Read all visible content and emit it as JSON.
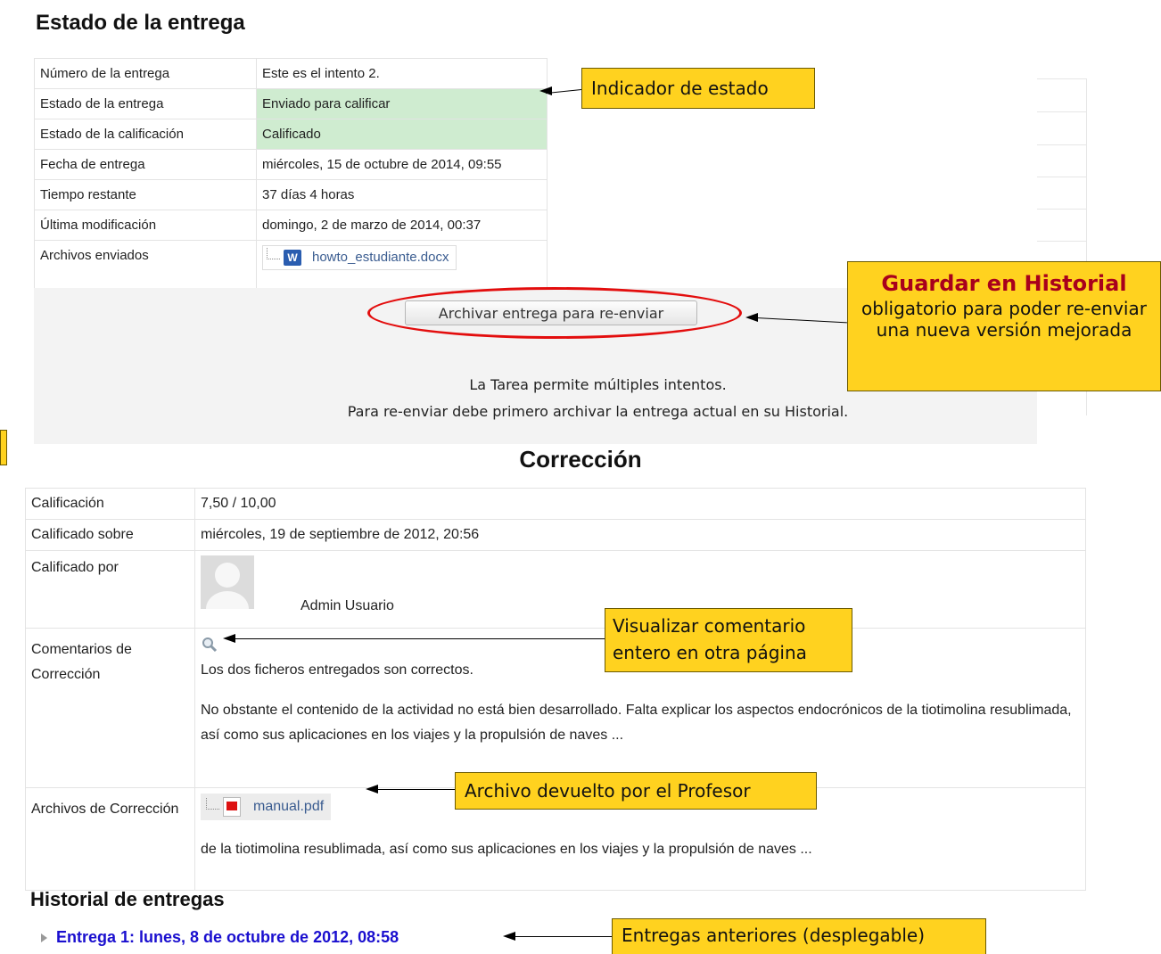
{
  "status": {
    "title": "Estado de la entrega",
    "rows": [
      {
        "label": "Número de la entrega",
        "value": "Este es el intento 2."
      },
      {
        "label": "Estado de la entrega",
        "value": "Enviado para calificar"
      },
      {
        "label": "Estado de la calificación",
        "value": "Calificado"
      },
      {
        "label": "Fecha de entrega",
        "value": "miércoles, 15 de octubre de 2014, 09:55"
      },
      {
        "label": "Tiempo restante",
        "value": "37 días 4 horas"
      },
      {
        "label": "Última modificación",
        "value": "domingo, 2 de marzo de 2014, 00:37"
      },
      {
        "label": "Archivos enviados",
        "value": "howto_estudiante.docx"
      }
    ],
    "highlight_color": "#cfecd0"
  },
  "archive": {
    "button_label": "Archivar entrega para re-enviar",
    "line1": "La Tarea permite múltiples intentos.",
    "line2": "Para re-enviar debe primero archivar la entrega actual en su Historial."
  },
  "correction": {
    "title": "Corrección",
    "grade_label": "Calificación",
    "grade_value": "7,50 / 10,00",
    "graded_on_label": "Calificado sobre",
    "graded_on_value": "miércoles, 19 de septiembre de 2012, 20:56",
    "graded_by_label": "Calificado por",
    "graded_by_value": "Admin Usuario",
    "comments_label": "Comentarios de Corrección",
    "comment_p1": "Los dos ficheros entregados son correctos.",
    "comment_p2": "No obstante el contenido de la actividad no está bien desarrollado.  Falta explicar los aspectos endocrónicos de la tiotimolina resublimada, así como sus aplicaciones en los viajes y la propulsión de naves ...",
    "files_label": "Archivos de Corrección",
    "file_name": "manual.pdf",
    "files_extra": "de la tiotimolina resublimada, así como sus aplicaciones en los viajes y la propulsión de naves ..."
  },
  "history": {
    "title": "Historial de entregas",
    "item": "Entrega 1: lunes, 8 de octubre de 2012, 08:58"
  },
  "notes": {
    "status_indicator": "Indicador de estado",
    "save_history_title": "Guardar en Historial",
    "save_history_body": "obligatorio para poder re-enviar una nueva versión mejorada",
    "view_comment": "Visualizar comentario entero en otra página",
    "returned_file": "Archivo devuelto por el Profesor",
    "previous": "Entregas anteriores (desplegable)",
    "accent_color": "#ffd21f",
    "title_color": "#a8001c",
    "ellipse_color": "#e30d0d"
  },
  "icons": {
    "word": "word-document-icon",
    "pdf": "pdf-file-icon",
    "magnifier": "magnifier-icon",
    "expand": "expand-triangle-icon",
    "avatar": "user-avatar"
  }
}
